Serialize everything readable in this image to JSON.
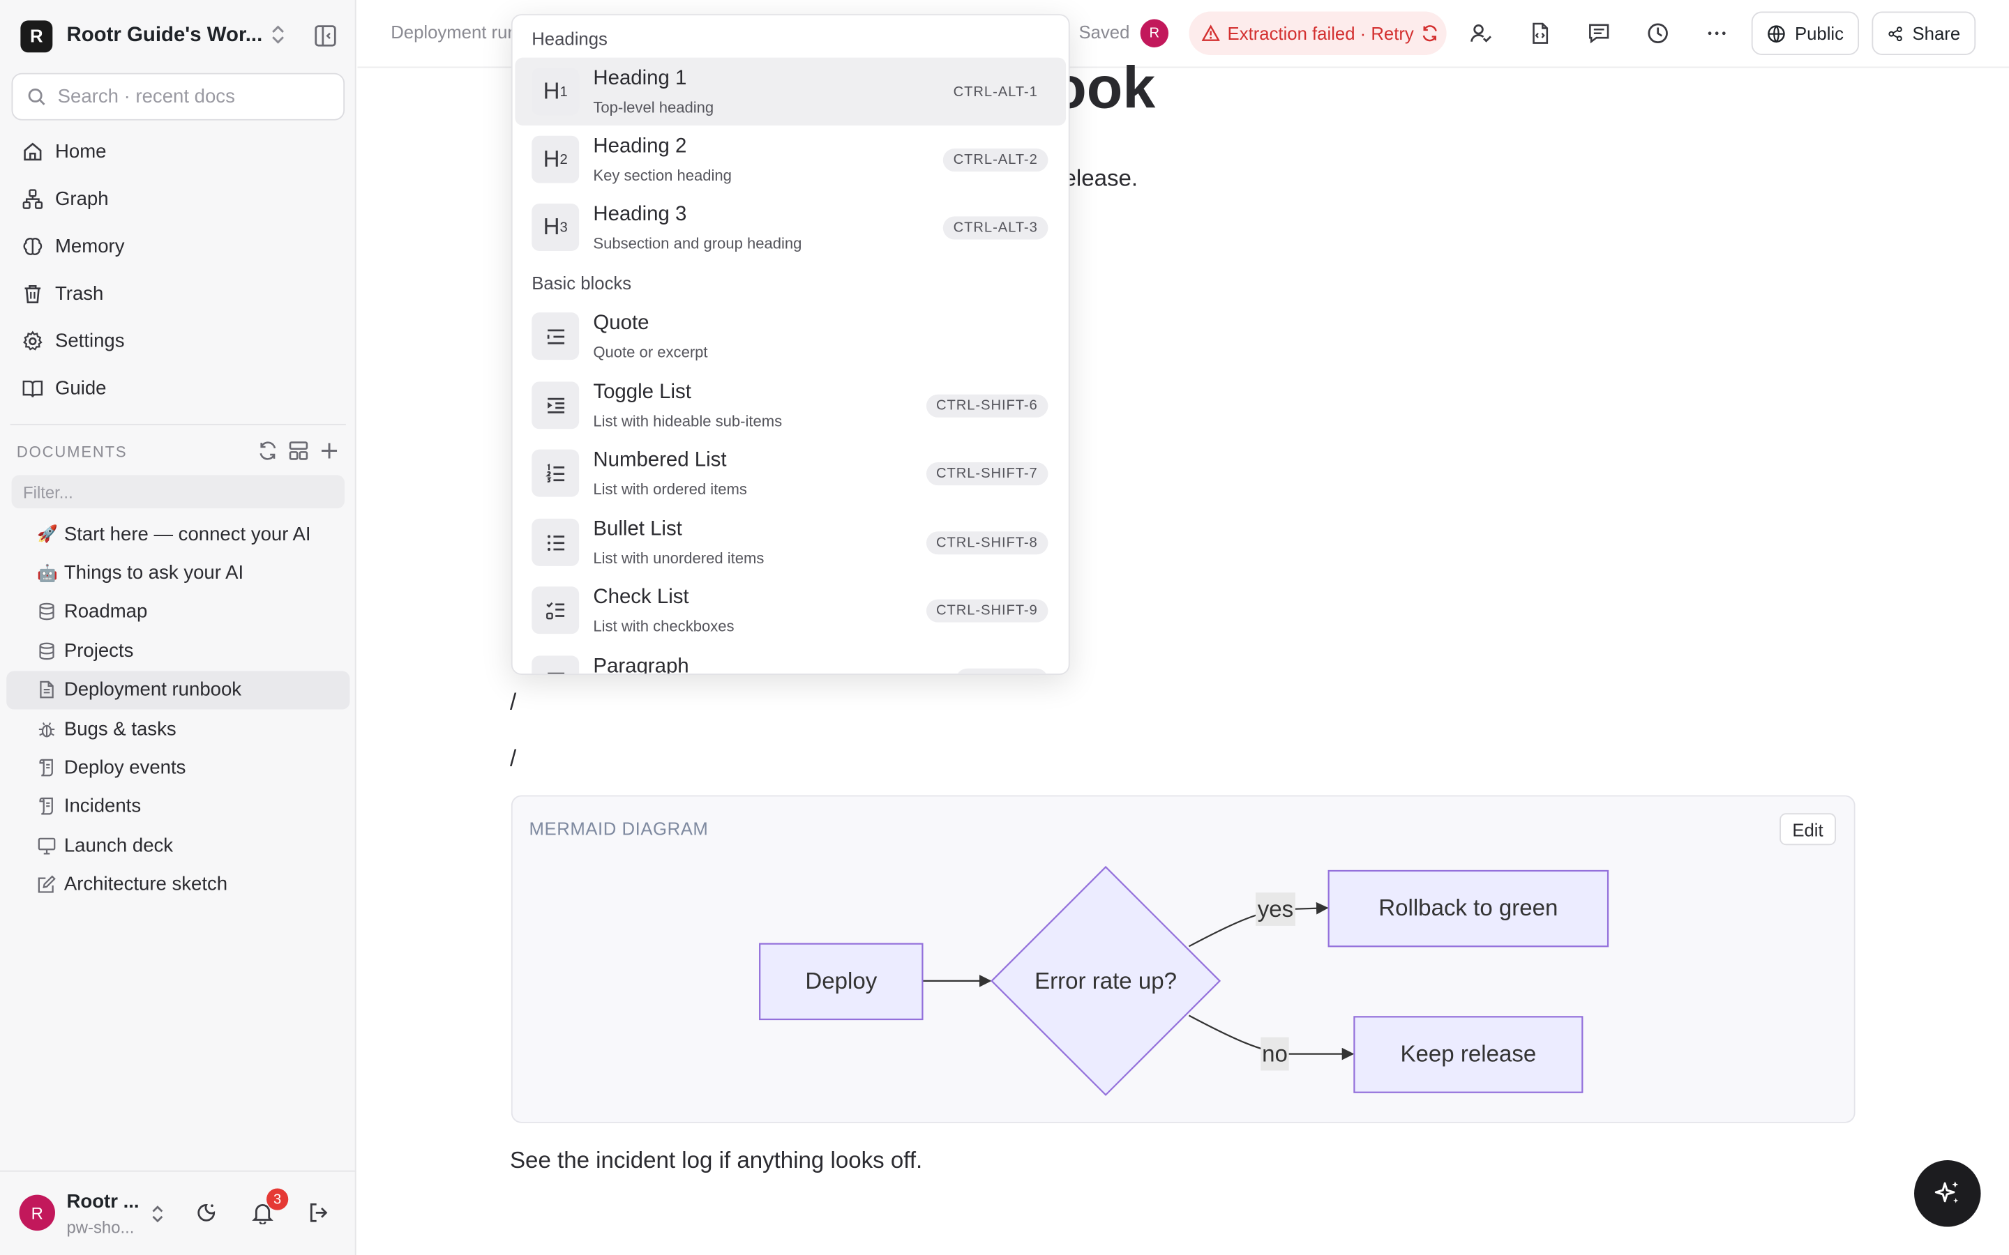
{
  "workspace": {
    "logo_letter": "R",
    "name": "Rootr Guide's Wor..."
  },
  "search": {
    "placeholder": "Search · recent docs"
  },
  "nav": [
    {
      "label": "Home",
      "icon": "home-icon"
    },
    {
      "label": "Graph",
      "icon": "graph-icon"
    },
    {
      "label": "Memory",
      "icon": "brain-icon"
    },
    {
      "label": "Trash",
      "icon": "trash-icon"
    },
    {
      "label": "Settings",
      "icon": "gear-icon"
    },
    {
      "label": "Guide",
      "icon": "book-icon"
    }
  ],
  "documents": {
    "section_label": "DOCUMENTS",
    "filter_placeholder": "Filter...",
    "items": [
      {
        "label": "Start here — connect your AI",
        "icon": "rocket-emoji",
        "glyph": "🚀"
      },
      {
        "label": "Things to ask your AI",
        "icon": "robot-emoji",
        "glyph": "🤖"
      },
      {
        "label": "Roadmap",
        "icon": "database-icon"
      },
      {
        "label": "Projects",
        "icon": "database-icon"
      },
      {
        "label": "Deployment runbook",
        "icon": "document-icon",
        "active": true
      },
      {
        "label": "Bugs & tasks",
        "icon": "bug-icon"
      },
      {
        "label": "Deploy events",
        "icon": "log-icon"
      },
      {
        "label": "Incidents",
        "icon": "log-icon"
      },
      {
        "label": "Launch deck",
        "icon": "presentation-icon"
      },
      {
        "label": "Architecture sketch",
        "icon": "sketch-icon"
      }
    ]
  },
  "user": {
    "avatar_letter": "R",
    "name": "Rootr ...",
    "sub": "pw-sho...",
    "notifications": "3"
  },
  "topbar": {
    "breadcrumb": "Deployment runbook",
    "saved": "Saved",
    "avatar_letter": "R",
    "error_text": "Extraction failed · Retry",
    "public_label": "Public",
    "share_label": "Share"
  },
  "doc": {
    "title_fragment": "ook",
    "line_fragment": "elease.",
    "slash_lines": [
      "/",
      "/"
    ],
    "after_text": "See the incident log if anything looks off."
  },
  "mermaid": {
    "label": "MERMAID DIAGRAM",
    "edit_label": "Edit",
    "nodes": {
      "deploy": "Deploy",
      "decision": "Error rate up?",
      "rollback": "Rollback to green",
      "keep": "Keep release"
    },
    "edges": {
      "yes": "yes",
      "no": "no"
    },
    "colors": {
      "node_fill": "#ececff",
      "node_stroke": "#9370db"
    }
  },
  "menu": {
    "groups": [
      "Headings",
      "Basic blocks"
    ],
    "items": [
      {
        "tile": "H",
        "tile_sub": "1",
        "name": "Heading 1",
        "desc": "Top-level heading",
        "shortcut": "CTRL-ALT-1",
        "highlighted": true
      },
      {
        "tile": "H",
        "tile_sub": "2",
        "name": "Heading 2",
        "desc": "Key section heading",
        "shortcut": "CTRL-ALT-2"
      },
      {
        "tile": "H",
        "tile_sub": "3",
        "name": "Heading 3",
        "desc": "Subsection and group heading",
        "shortcut": "CTRL-ALT-3"
      },
      {
        "tile_icon": "quote-icon",
        "name": "Quote",
        "desc": "Quote or excerpt",
        "shortcut": ""
      },
      {
        "tile_icon": "toggle-list-icon",
        "name": "Toggle List",
        "desc": "List with hideable sub-items",
        "shortcut": "CTRL-SHIFT-6"
      },
      {
        "tile_icon": "numbered-list-icon",
        "name": "Numbered List",
        "desc": "List with ordered items",
        "shortcut": "CTRL-SHIFT-7"
      },
      {
        "tile_icon": "bullet-list-icon",
        "name": "Bullet List",
        "desc": "List with unordered items",
        "shortcut": "CTRL-SHIFT-8"
      },
      {
        "tile_icon": "check-list-icon",
        "name": "Check List",
        "desc": "List with checkboxes",
        "shortcut": "CTRL-SHIFT-9"
      },
      {
        "tile_icon": "paragraph-icon",
        "name": "Paragraph",
        "desc": "",
        "shortcut": ""
      }
    ]
  },
  "colors": {
    "accent_error": "#d32f2f",
    "avatar": "#c2185b"
  }
}
